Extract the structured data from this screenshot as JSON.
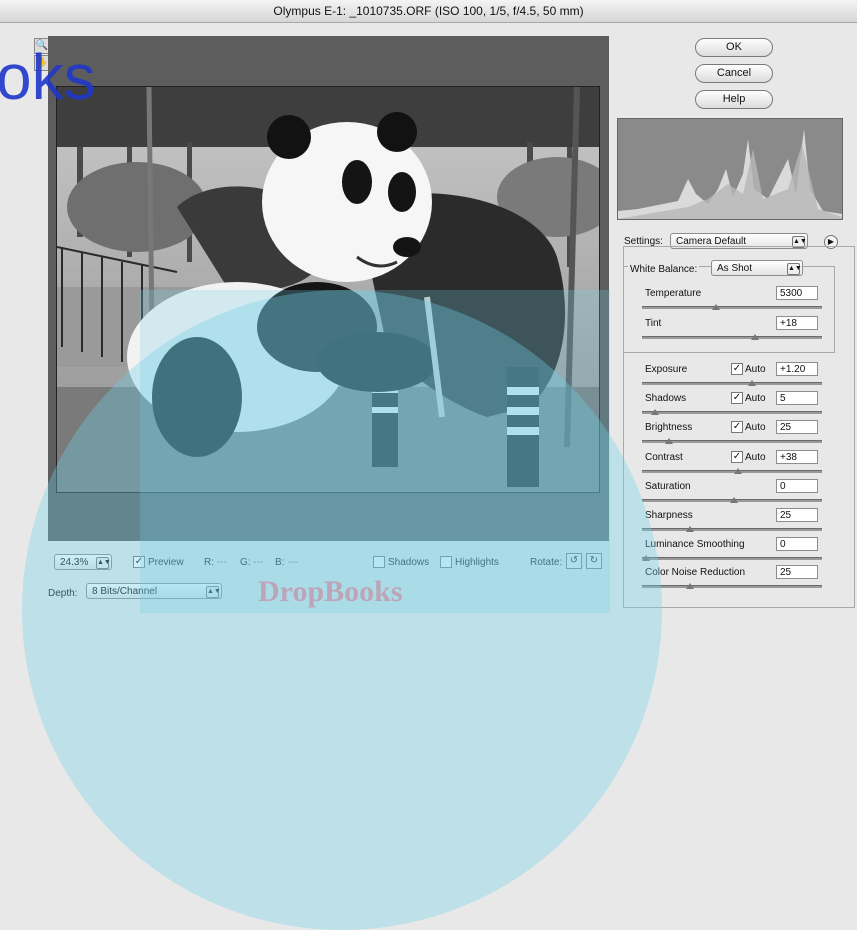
{
  "window": {
    "title": "Olympus E-1: _1010735.ORF  (ISO 100, 1/5, f/4.5, 50 mm)"
  },
  "buttons": {
    "ok": "OK",
    "cancel": "Cancel",
    "help": "Help"
  },
  "settings": {
    "label": "Settings:",
    "value": "Camera Default"
  },
  "white_balance": {
    "label": "White Balance:",
    "value": "As Shot"
  },
  "adjust": [
    {
      "key": "temperature",
      "label": "Temperature",
      "value": "5300",
      "auto": null,
      "slider": 0.4
    },
    {
      "key": "tint",
      "label": "Tint",
      "value": "+18",
      "auto": null,
      "slider": 0.62
    },
    {
      "key": "exposure",
      "label": "Exposure",
      "value": "+1.20",
      "auto": "Auto",
      "slider": 0.6
    },
    {
      "key": "shadows",
      "label": "Shadows",
      "value": "5",
      "auto": "Auto",
      "slider": 0.05
    },
    {
      "key": "brightness",
      "label": "Brightness",
      "value": "25",
      "auto": "Auto",
      "slider": 0.13
    },
    {
      "key": "contrast",
      "label": "Contrast",
      "value": "+38",
      "auto": "Auto",
      "slider": 0.52
    },
    {
      "key": "saturation",
      "label": "Saturation",
      "value": "0",
      "auto": null,
      "slider": 0.5
    },
    {
      "key": "sharpness",
      "label": "Sharpness",
      "value": "25",
      "auto": null,
      "slider": 0.25
    },
    {
      "key": "luminance",
      "label": "Luminance Smoothing",
      "value": "0",
      "auto": null,
      "slider": 0.0
    },
    {
      "key": "colornoise",
      "label": "Color Noise Reduction",
      "value": "25",
      "auto": null,
      "slider": 0.25
    }
  ],
  "bottom": {
    "zoom": "24.3%",
    "preview": "Preview",
    "r": "R:",
    "g": "G:",
    "b": "B:",
    "rgb_dash": "---",
    "shadows": "Shadows",
    "highlights": "Highlights",
    "rotate": "Rotate:",
    "depth_label": "Depth:",
    "depth_value": "8 Bits/Channel"
  },
  "watermark": {
    "left_text": "oks",
    "bottom_text": "DropBooks"
  },
  "colors": {
    "watermark_blue": "#1f37c9",
    "watermark_cyan": "#6fd0e8",
    "watermark_red": "#e23b5a"
  }
}
